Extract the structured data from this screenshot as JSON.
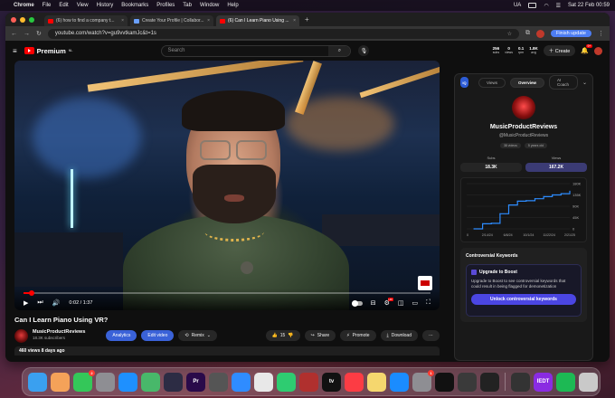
{
  "menubar": {
    "app": "Chrome",
    "items": [
      "File",
      "Edit",
      "View",
      "History",
      "Bookmarks",
      "Profiles",
      "Tab",
      "Window",
      "Help"
    ],
    "status_ua": "UA",
    "clock": "Sat 22 Feb 00:59"
  },
  "browser": {
    "tabs": [
      {
        "label": "(6) how to find a company t...",
        "icon": "youtube-favicon"
      },
      {
        "label": "Create Your Profile | Collabor...",
        "icon": "collab-favicon"
      },
      {
        "label": "(6) Can I Learn Piano Using ...",
        "icon": "youtube-favicon",
        "active": true
      }
    ],
    "url": "youtube.com/watch?v=gu9vvtkamJc&t=1s",
    "finish_update": "Finish update"
  },
  "youtube": {
    "logo": "Premium",
    "logo_region": "NL",
    "search_placeholder": "Search",
    "header_stats": [
      {
        "value": "256",
        "label": "subs"
      },
      {
        "value": "0",
        "label": "views"
      },
      {
        "value": "0.1",
        "label": "rpm"
      },
      {
        "value": "1.8K",
        "label": "avg"
      }
    ],
    "create": "Create",
    "notifications": "9+"
  },
  "video": {
    "title": "Can I Learn Piano Using VR?",
    "time": "0:02 / 1:37",
    "progress": 0.02,
    "channel_name": "MusicProductReviews",
    "subscribers": "18.3K subscribers",
    "analytics": "Analytics",
    "edit_video": "Edit video",
    "remix": "Remix",
    "likes": "15",
    "share": "Share",
    "promote": "Promote",
    "download": "Download",
    "views_date": "460 views  8 days ago"
  },
  "panel": {
    "logo": "IQ",
    "tabs": [
      "Views",
      "Overview",
      "AI Coach"
    ],
    "active_tab": "Overview",
    "channel": "MusicProductReviews",
    "handle": "@MusicProductReviews",
    "chips": [
      "38 videos",
      "5 years old"
    ],
    "subs_label": "Subs",
    "subs_value": "18.3K",
    "views_label": "Views",
    "views_value": "167.2K",
    "keywords_header": "Controversial Keywords",
    "upgrade_title": "Upgrade to Boost",
    "upgrade_desc": "Upgrade to Boost to see controversial keywords that could result in being flagged for demonetization",
    "unlock_button": "Unlock controversial keywords"
  },
  "chart_data": {
    "type": "line",
    "x": [
      "0",
      "2/14/24",
      "6/8/24",
      "10/1/24",
      "11/22/24",
      "2/21/25"
    ],
    "y_ticks": [
      "0",
      "45K",
      "90K",
      "135K",
      "180K"
    ],
    "ylim": [
      0,
      180000
    ],
    "series": [
      {
        "values": [
          0,
          20000,
          22000,
          60000,
          95000,
          110000,
          112000,
          120000,
          128000,
          135000,
          140000,
          150000
        ]
      }
    ],
    "color": "#2d8cff"
  },
  "dock": {
    "icons": [
      {
        "name": "finder-icon",
        "color": "#3aa0f0"
      },
      {
        "name": "photos-icon",
        "color": "#f4a259"
      },
      {
        "name": "messages-icon",
        "color": "#34c759",
        "badge": "2"
      },
      {
        "name": "launchpad-icon",
        "color": "#8e8e93"
      },
      {
        "name": "mail-icon",
        "color": "#1e90ff"
      },
      {
        "name": "maps-icon",
        "color": "#48b86a"
      },
      {
        "name": "davinci-icon",
        "color": "#2c2c44"
      },
      {
        "name": "premiere-icon",
        "color": "#2a0a4a",
        "label": "Pr"
      },
      {
        "name": "logic-icon",
        "color": "#555"
      },
      {
        "name": "safari-icon",
        "color": "#2f8cff"
      },
      {
        "name": "chrome-icon",
        "color": "#e8e8e8"
      },
      {
        "name": "facetime-icon",
        "color": "#2ecc71"
      },
      {
        "name": "photo-booth-icon",
        "color": "#b0302e"
      },
      {
        "name": "appletv-icon",
        "color": "#111",
        "label": "tv"
      },
      {
        "name": "music-icon",
        "color": "#fc3c44"
      },
      {
        "name": "notes-icon",
        "color": "#f5d76e"
      },
      {
        "name": "appstore-icon",
        "color": "#1a8cff"
      },
      {
        "name": "settings-icon",
        "color": "#8e8e93",
        "badge": "1"
      },
      {
        "name": "capcut-icon",
        "color": "#111"
      },
      {
        "name": "sonarworks-icon",
        "color": "#3a3a3a"
      },
      {
        "name": "midi-icon",
        "color": "#222"
      },
      {
        "name": "calculator-icon",
        "color": "#333"
      },
      {
        "name": "iedt-icon",
        "color": "#8a2be2",
        "label": "IEDT"
      },
      {
        "name": "spotify-icon",
        "color": "#1db954"
      },
      {
        "name": "trash-icon",
        "color": "#c9c9c9"
      }
    ]
  }
}
